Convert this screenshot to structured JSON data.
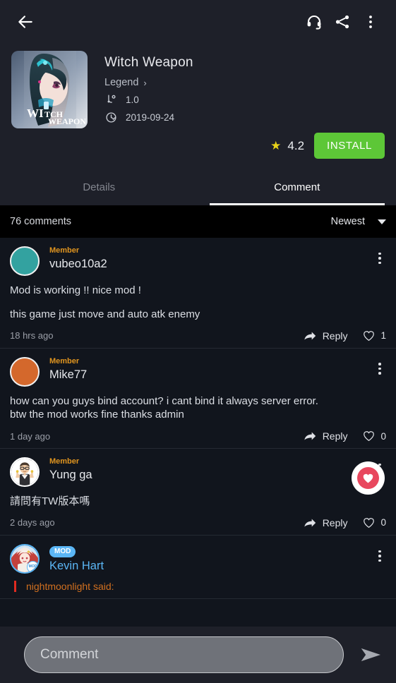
{
  "appbar": {
    "back_icon": "back-arrow-icon",
    "support_icon": "headset-icon",
    "share_icon": "share-icon",
    "more_icon": "overflow-menu-icon"
  },
  "app": {
    "title": "Witch Weapon",
    "developer": "Legend",
    "chevron": "›",
    "version": "1.0",
    "updated": "2019-09-24",
    "rating": "4.2",
    "star_glyph": "★",
    "install_label": "INSTALL",
    "install_color": "#5dc737",
    "icon_caption_line1": "WITCH",
    "icon_caption_line2": "WEAPON"
  },
  "tabs": [
    {
      "label": "Details",
      "active": false
    },
    {
      "label": "Comment",
      "active": true
    }
  ],
  "comments_header": {
    "count_label": "76 comments",
    "sort_label": "Newest"
  },
  "comments": [
    {
      "role": "Member",
      "username": "vubeo10a2",
      "avatar_kind": "teal",
      "lines": [
        "Mod is working !! nice mod !",
        "this game just move and auto atk enemy"
      ],
      "timestamp": "18 hrs ago",
      "reply_label": "Reply",
      "likes": "1",
      "heart_popup": false
    },
    {
      "role": "Member",
      "username": "Mike77",
      "avatar_kind": "orange",
      "lines": [
        "how can you guys bind account? i cant bind it always server error.",
        "btw the mod works fine thanks admin"
      ],
      "timestamp": "1 day ago",
      "reply_label": "Reply",
      "likes": "0",
      "heart_popup": false
    },
    {
      "role": "Member",
      "username": "Yung ga",
      "avatar_kind": "memoji",
      "lines": [
        "請問有TW版本嗎"
      ],
      "timestamp": "2 days ago",
      "reply_label": "Reply",
      "likes": "0",
      "heart_popup": true
    },
    {
      "role": "MOD",
      "username": "Kevin Hart",
      "avatar_kind": "mod",
      "mod_sub_badge": "MOD",
      "quote_author": "nightmoonlight said:",
      "lines": [],
      "timestamp": "",
      "reply_label": "",
      "likes": "",
      "heart_popup": false
    }
  ],
  "composer": {
    "placeholder": "Comment",
    "value": "",
    "send_icon": "send-icon"
  }
}
